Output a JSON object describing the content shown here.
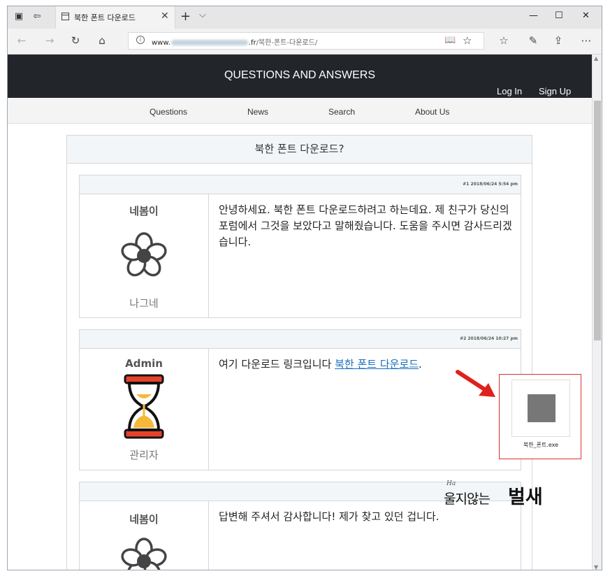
{
  "browser": {
    "tab_title": "북한 폰트 다운로드",
    "url_domain_suffix": ".fr",
    "url_host_prefix": "www.",
    "url_path": "/북한-폰트-다운로드/"
  },
  "site": {
    "title": "QUESTIONS AND ANSWERS",
    "login": "Log In",
    "signup": "Sign Up",
    "menu": [
      "Questions",
      "News",
      "Search",
      "About Us"
    ]
  },
  "topic": {
    "title": "북한 폰트 다운로드?"
  },
  "posts": [
    {
      "meta": "#1 2018/06/24 5:54 pm",
      "username": "네봄이",
      "role": "나그네",
      "avatar": "flower-icon",
      "body": "안녕하세요. 북한 폰트 다운로드하려고 하는데요. 제 친구가 당신의 포럼에서 그것을 보았다고 말해줬습니다. 도움을 주시면 감사드리겠습니다."
    },
    {
      "meta": "#2 2018/06/24 10:27 pm",
      "username": "Admin",
      "role": "관리자",
      "avatar": "hourglass-icon",
      "body_prefix": "여기 다운로드 링크입니다 ",
      "body_link": "북한 폰트 다운로드",
      "body_suffix": "."
    },
    {
      "meta": "",
      "username": "네봄이",
      "role": "",
      "avatar": "flower-icon",
      "body": "답변해 주셔서 감사합니다! 제가 찾고 있던 겁니다."
    }
  ],
  "attachment": {
    "filename": "북한_폰트.exe"
  },
  "watermark": {
    "line1": "Ha",
    "line2": "울지않는",
    "line3": "벌새"
  },
  "colors": {
    "header_bg": "#22252a",
    "highlight": "#d93030",
    "link": "#1a6fbf"
  }
}
